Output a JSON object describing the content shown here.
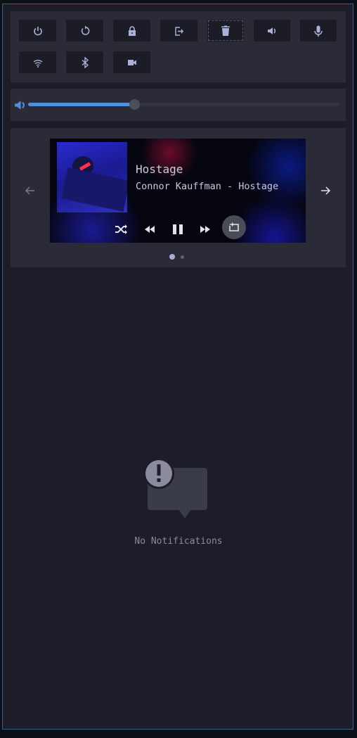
{
  "quick_buttons": [
    {
      "icon": "power-icon"
    },
    {
      "icon": "reboot-icon"
    },
    {
      "icon": "lock-icon"
    },
    {
      "icon": "logout-icon"
    },
    {
      "icon": "trash-icon",
      "focused": true
    },
    {
      "icon": "speaker-icon"
    },
    {
      "icon": "microphone-icon"
    },
    {
      "icon": "wifi-icon"
    },
    {
      "icon": "bluetooth-icon"
    },
    {
      "icon": "camera-icon"
    }
  ],
  "volume": {
    "icon": "volume-icon",
    "level_percent": 34,
    "accent": "#4f8fe0"
  },
  "media": {
    "title": "Hostage",
    "artist_line": "Connor Kauffman - Hostage",
    "state": "playing",
    "page": 1,
    "pages": 2
  },
  "notifications": {
    "empty_text": "No Notifications"
  },
  "colors": {
    "background": "#1c1d28",
    "panel": "#2b2b38",
    "icon": "#aab1d9",
    "border": "#3d5d92"
  }
}
